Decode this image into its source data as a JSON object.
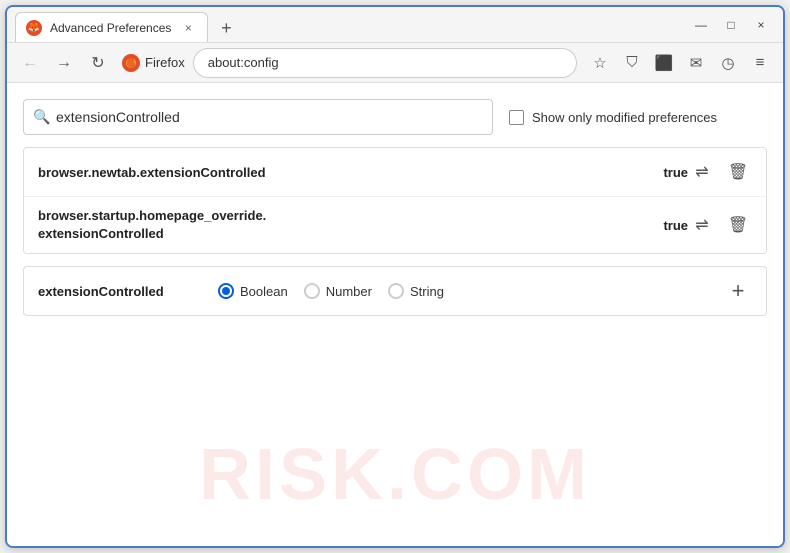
{
  "window": {
    "title": "Advanced Preferences",
    "favicon": "🦊",
    "close_label": "×",
    "minimize_label": "—",
    "maximize_label": "□",
    "new_tab_label": "+"
  },
  "nav": {
    "back_label": "←",
    "forward_label": "→",
    "reload_label": "↻",
    "browser_name": "Firefox",
    "url": "about:config",
    "bookmark_icon": "☆",
    "pocket_icon": "⛉",
    "extension_icon": "⬛",
    "sync_icon": "✉",
    "history_icon": "◷",
    "menu_icon": "≡"
  },
  "search": {
    "placeholder": "extensionControlled",
    "value": "extensionControlled",
    "show_modified_label": "Show only modified preferences"
  },
  "results": [
    {
      "name": "browser.newtab.extensionControlled",
      "value": "true"
    },
    {
      "name_line1": "browser.startup.homepage_override.",
      "name_line2": "extensionControlled",
      "value": "true"
    }
  ],
  "add_pref": {
    "name": "extensionControlled",
    "type_options": [
      {
        "label": "Boolean",
        "selected": true
      },
      {
        "label": "Number",
        "selected": false
      },
      {
        "label": "String",
        "selected": false
      }
    ],
    "add_btn_label": "+"
  },
  "watermark": "RISK.COM",
  "icons": {
    "search": "🔍",
    "swap": "⇌",
    "delete": "🗑",
    "checkbox": "☐"
  }
}
